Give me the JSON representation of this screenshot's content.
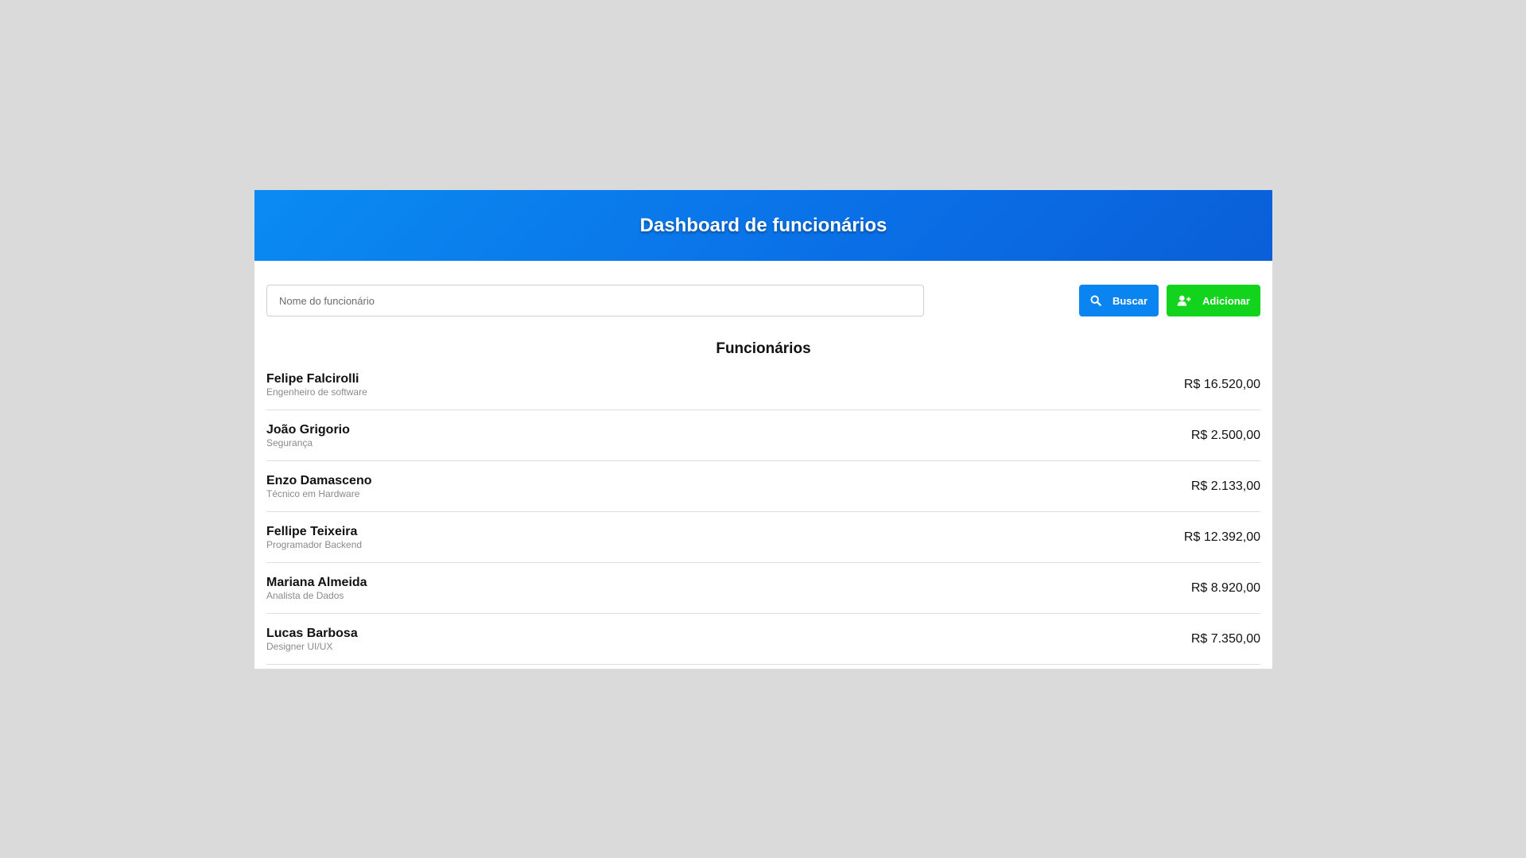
{
  "header": {
    "title": "Dashboard de funcionários"
  },
  "search": {
    "placeholder": "Nome do funcionário",
    "value": ""
  },
  "buttons": {
    "search_label": "Buscar",
    "add_label": "Adicionar"
  },
  "icons": {
    "search": "search-icon",
    "add": "add-user-icon"
  },
  "colors": {
    "header": "#0a7ff0",
    "search_button": "#0a84f0",
    "add_button": "#12d41d",
    "background": "#dadada"
  },
  "list": {
    "title": "Funcionários",
    "employees": [
      {
        "name": "Felipe Falcirolli",
        "role": "Engenheiro de software",
        "salary": "R$ 16.520,00"
      },
      {
        "name": "João Grigorio",
        "role": "Segurança",
        "salary": "R$ 2.500,00"
      },
      {
        "name": "Enzo Damasceno",
        "role": "Técnico em Hardware",
        "salary": "R$ 2.133,00"
      },
      {
        "name": "Fellipe Teixeira",
        "role": "Programador Backend",
        "salary": "R$ 12.392,00"
      },
      {
        "name": "Mariana Almeida",
        "role": "Analista de Dados",
        "salary": "R$ 8.920,00"
      },
      {
        "name": "Lucas Barbosa",
        "role": "Designer UI/UX",
        "salary": "R$ 7.350,00"
      }
    ]
  }
}
